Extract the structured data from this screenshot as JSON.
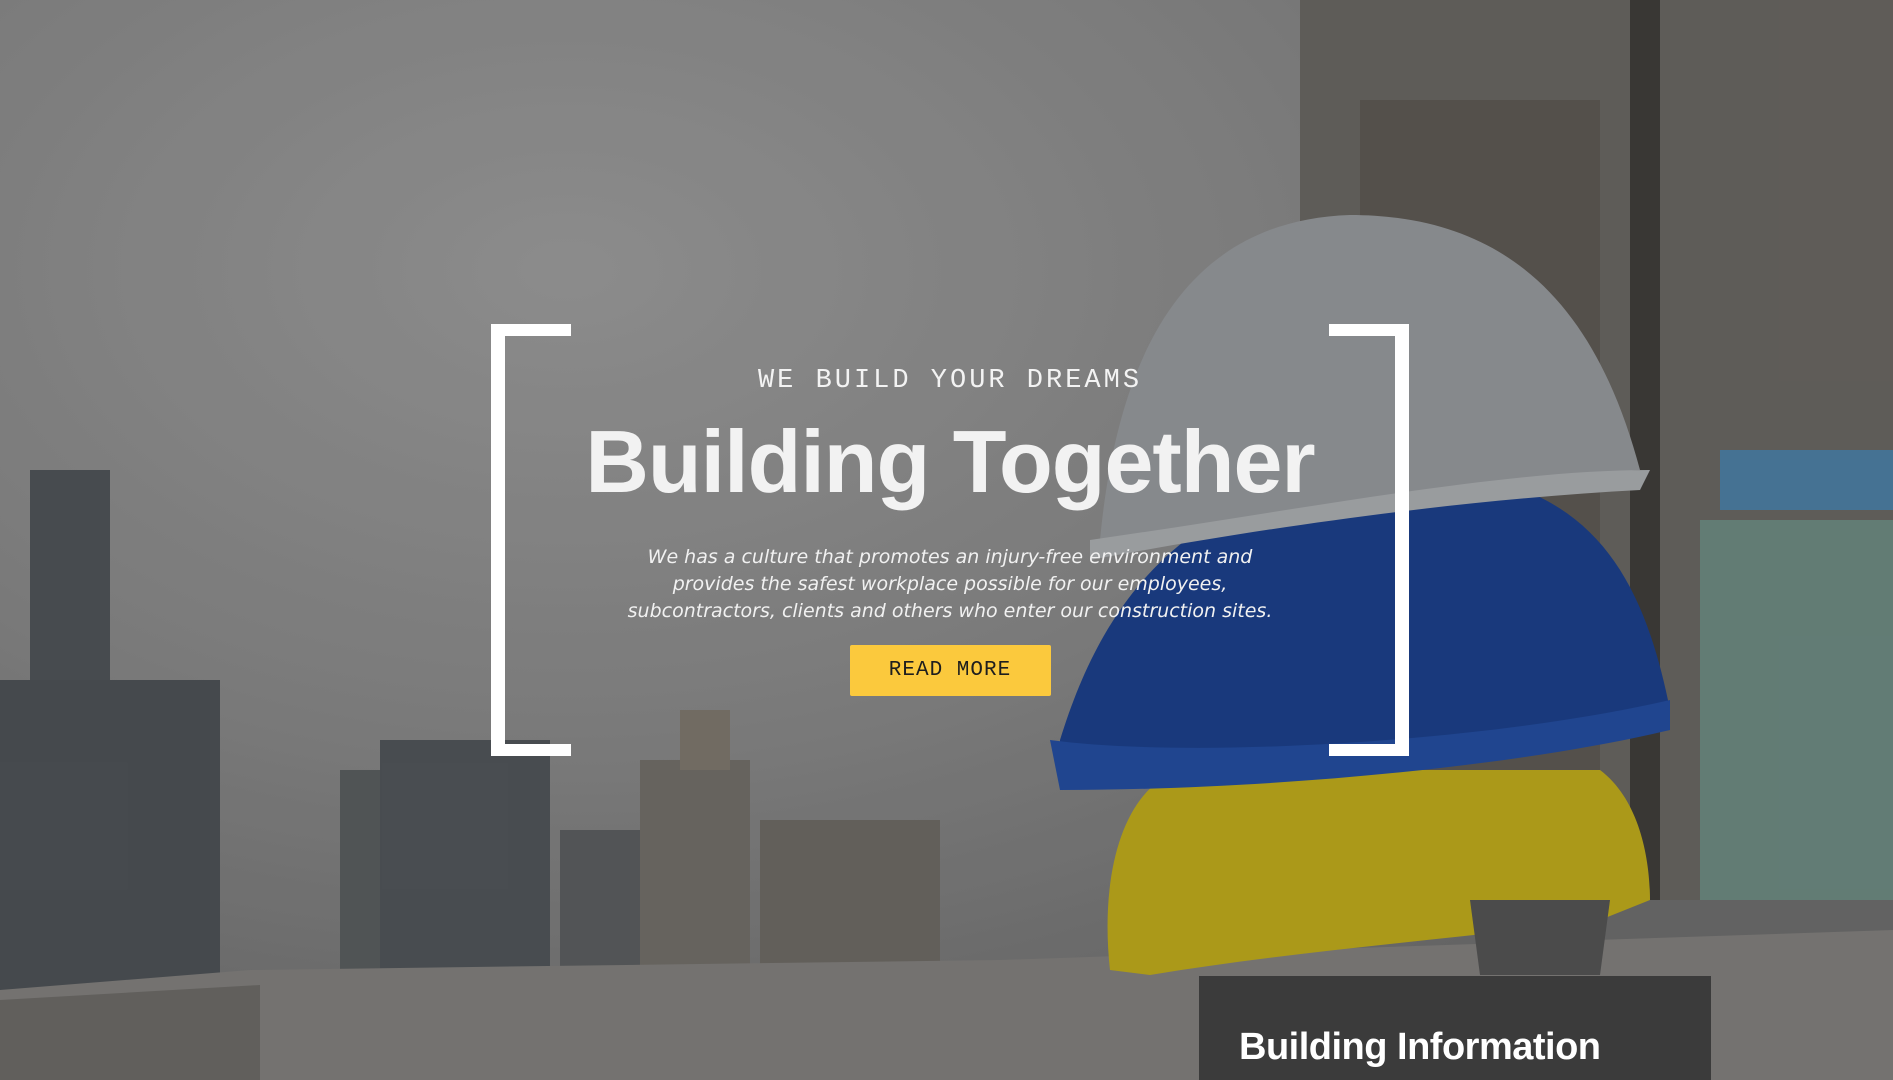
{
  "hero": {
    "eyebrow": "WE BUILD YOUR DREAMS",
    "title": "Building Together",
    "description": "We has a culture that promotes an injury-free environment and provides the safest workplace possible for our employees, subcontractors, clients and others who enter our construction sites.",
    "button_label": "READ MORE"
  },
  "info_panel": {
    "title": "Building Information"
  },
  "colors": {
    "accent": "#fbc93d",
    "panel": "#3b3b3b",
    "text": "#ffffff"
  },
  "icons": {
    "background": "construction-helmets-photo"
  }
}
